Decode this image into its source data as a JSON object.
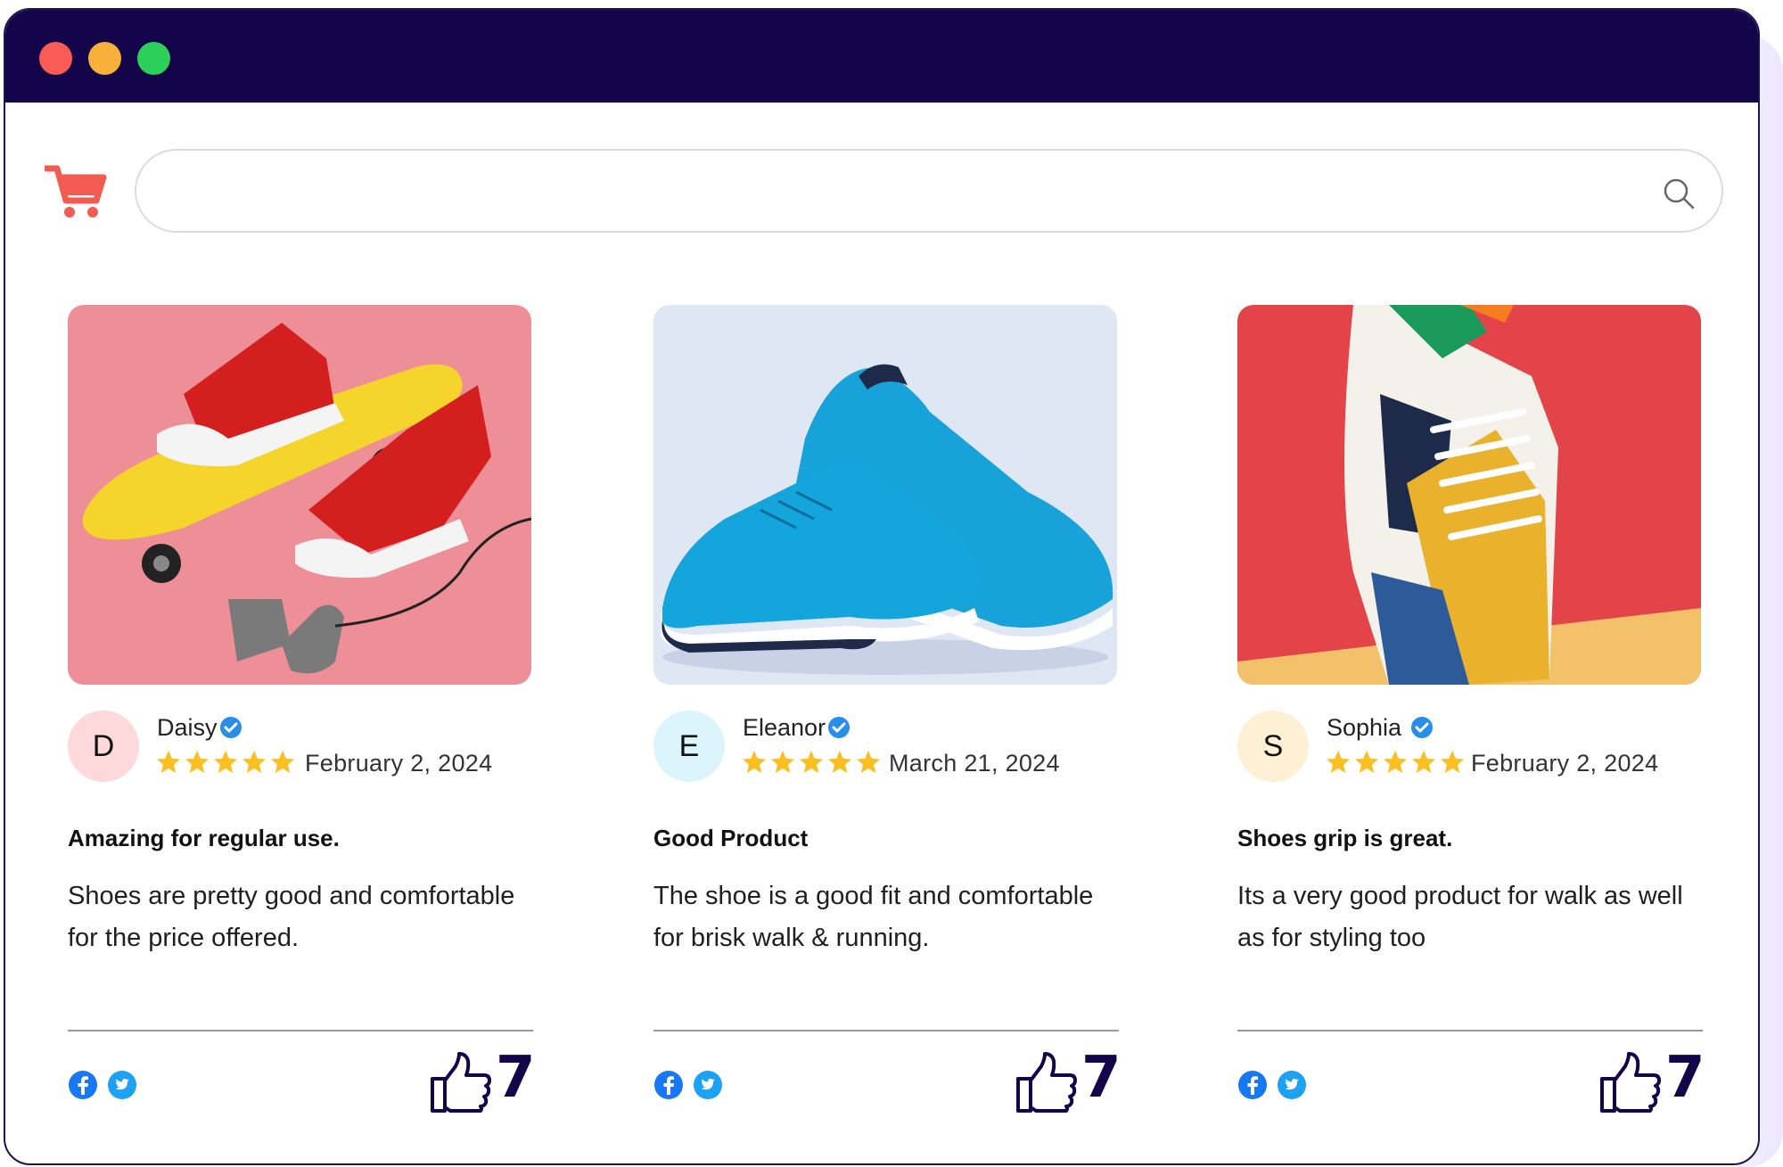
{
  "window": {
    "controls": [
      "close",
      "minimize",
      "maximize"
    ]
  },
  "search": {
    "value": "",
    "placeholder": ""
  },
  "colors": {
    "titlebar": "#14044a",
    "cart": "#f25a52",
    "star": "#fbbf24",
    "verified": "#2a8de8",
    "like": "#14044a"
  },
  "reviews": [
    {
      "initial": "D",
      "avatar_color": "#fdd9dc",
      "name": "Daisy",
      "verified": true,
      "rating": 5,
      "date": "February 2, 2024",
      "title": "Amazing for regular use.",
      "body": "Shoes are pretty good and comfortable for the price offered.",
      "likes": "7",
      "image_icon": "red-sneakers-skateboard"
    },
    {
      "initial": "E",
      "avatar_color": "#dcf4fc",
      "name": "Eleanor",
      "verified": true,
      "rating": 5,
      "date": "March 21, 2024",
      "title": "Good Product",
      "body": "The shoe is a good fit and comfortable for brisk walk & running.",
      "likes": "7",
      "image_icon": "blue-running-shoes"
    },
    {
      "initial": "S",
      "avatar_color": "#fdf0d5",
      "name": "Sophia",
      "verified": true,
      "rating": 5,
      "date": "February 2, 2024",
      "title": "Shoes grip is great.",
      "body": "Its a very good product for walk as well as for styling too",
      "likes": "7",
      "image_icon": "colorful-sneaker"
    }
  ]
}
